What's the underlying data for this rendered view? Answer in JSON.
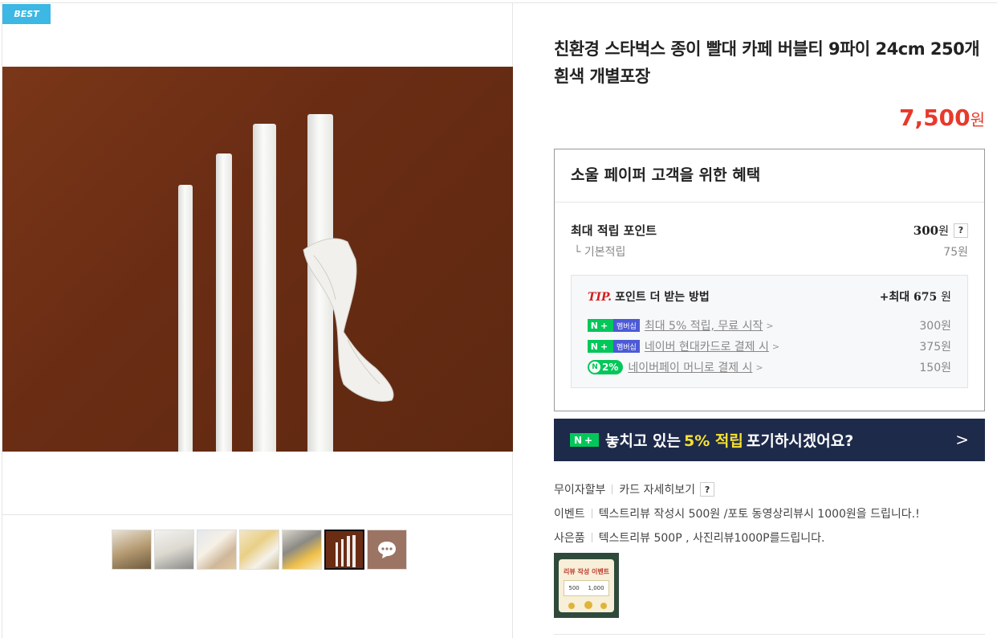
{
  "badge": "BEST",
  "product": {
    "title": "친환경 스타벅스 종이 빨대 카페 버블티 9파이 24cm 250개 흰색 개별포장",
    "price": "7,500",
    "currency": "원"
  },
  "benefit": {
    "title": "소울 페이퍼 고객을 위한 혜택",
    "max_points_label": "최대 적립 포인트",
    "max_points_value": "300",
    "max_points_unit": "원",
    "help": "?",
    "base_label": "└ 기본적립",
    "base_value": "75원",
    "tip": {
      "tag": "TIP.",
      "label": "포인트 더 받는 방법",
      "total_prefix": "+최대",
      "total_value": "675",
      "total_unit": "원",
      "rows": [
        {
          "badge_n": "N+",
          "badge_m": "멤버십",
          "text": "최대 5% 적립, 무료 시작",
          "value": "300원"
        },
        {
          "badge_n": "N+",
          "badge_m": "멤버십",
          "text": "네이버 현대카드로 결제 시",
          "value": "375원"
        },
        {
          "badge_coin": "N",
          "badge_pct": "2%",
          "text": "네이버페이 머니로 결제 시",
          "value": "150원"
        }
      ]
    }
  },
  "banner": {
    "badge": "N+",
    "text1": "놓치고 있는",
    "highlight": "5% 적립",
    "text2": "포기하시겠어요?"
  },
  "infos": [
    {
      "label": "무이자할부",
      "text": "카드 자세히보기",
      "help": "?"
    },
    {
      "label": "이벤트",
      "text": "텍스트리뷰 작성시 500원 /포토 동영상리뷰시 1000원을 드립니다.!"
    },
    {
      "label": "사은품",
      "text": "텍스트리뷰 500P , 사진리뷰1000P를드립니다."
    }
  ],
  "event_image": {
    "line1": "리뷰 작성 이벤트",
    "v1": "500",
    "v2": "1,000"
  },
  "colors": {
    "price": "#e8392b",
    "naver_green": "#03c75a",
    "banner_bg": "#1e2a4a",
    "best_badge": "#3db7e4"
  },
  "thumbnail_icons": [
    "thumb-1",
    "thumb-2",
    "thumb-3",
    "thumb-4",
    "thumb-5",
    "thumb-6-active",
    "more-icon"
  ]
}
